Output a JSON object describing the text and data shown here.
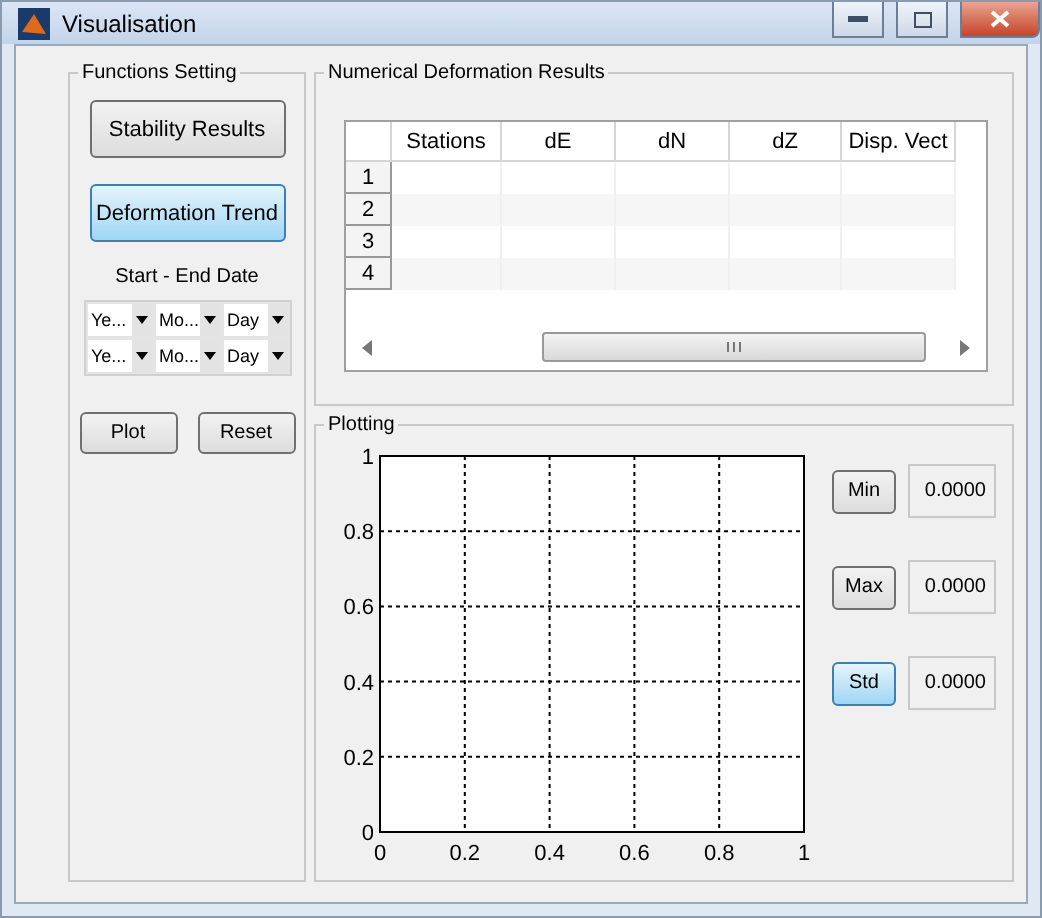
{
  "window": {
    "title": "Visualisation"
  },
  "functions_setting": {
    "title": "Functions Setting",
    "buttons": [
      {
        "label": "Stability Results",
        "focused": false
      },
      {
        "label": "Deformation Trend",
        "focused": true
      }
    ],
    "date_label": "Start - End Date",
    "date_rows": [
      [
        "Ye...",
        "Mo...",
        "Day"
      ],
      [
        "Ye...",
        "Mo...",
        "Day"
      ]
    ],
    "actions": [
      {
        "label": "Plot",
        "focused": false
      },
      {
        "label": "Reset",
        "focused": false
      }
    ]
  },
  "results": {
    "title": "Numerical Deformation Results",
    "columns": [
      "Stations",
      "dE",
      "dN",
      "dZ",
      "Disp. Vect"
    ],
    "rows": [
      "1",
      "2",
      "3",
      "4"
    ]
  },
  "plotting": {
    "title": "Plotting",
    "chart_data": {
      "type": "line",
      "grid": true,
      "xlim": [
        0,
        1
      ],
      "ylim": [
        0,
        1
      ],
      "xticks": [
        0,
        0.2,
        0.4,
        0.6,
        0.8,
        1
      ],
      "yticks": [
        0,
        0.2,
        0.4,
        0.6,
        0.8,
        1
      ]
    },
    "stats": [
      {
        "label": "Min",
        "value": "0.0000",
        "focused": false
      },
      {
        "label": "Max",
        "value": "0.0000",
        "focused": false
      },
      {
        "label": "Std",
        "value": "0.0000",
        "focused": true
      }
    ]
  }
}
